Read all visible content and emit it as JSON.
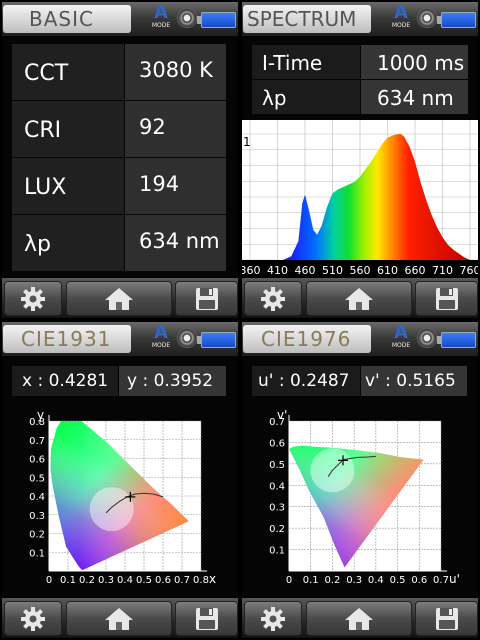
{
  "icons": {
    "mode": "mode-a-icon",
    "disc": "disc-icon",
    "battery": "battery-icon",
    "settings": "gear-icon",
    "home": "home-icon",
    "save": "floppy-disk-icon"
  },
  "mode_label": "A",
  "mode_sub": "MODE",
  "basic": {
    "title": "BASIC",
    "rows": [
      {
        "label": "CCT",
        "value": "3080 K"
      },
      {
        "label": "CRI",
        "value": "92"
      },
      {
        "label": "LUX",
        "value": "194"
      },
      {
        "label": "λp",
        "value": "634 nm"
      }
    ]
  },
  "spectrum": {
    "title": "SPECTRUM",
    "itime_label": "I-Time",
    "itime_value": "1000 ms",
    "peak_label": "λp",
    "peak_value": "634 nm",
    "chart_data": {
      "type": "area",
      "x_ticks": [
        "360",
        "410",
        "460",
        "510",
        "560",
        "610",
        "660",
        "710",
        "760"
      ],
      "ylim": [
        0,
        1
      ],
      "y_tick": "1",
      "x": [
        360,
        400,
        420,
        435,
        448,
        455,
        460,
        468,
        475,
        482,
        490,
        500,
        510,
        520,
        530,
        540,
        550,
        560,
        570,
        580,
        590,
        600,
        610,
        620,
        630,
        634,
        640,
        650,
        660,
        670,
        680,
        690,
        700,
        710,
        720,
        730,
        740,
        750,
        760
      ],
      "values": [
        0,
        0,
        0,
        0.03,
        0.15,
        0.45,
        0.52,
        0.38,
        0.24,
        0.2,
        0.27,
        0.42,
        0.53,
        0.56,
        0.58,
        0.6,
        0.62,
        0.66,
        0.72,
        0.78,
        0.85,
        0.92,
        0.97,
        0.99,
        1.0,
        1.0,
        0.98,
        0.9,
        0.78,
        0.62,
        0.48,
        0.36,
        0.26,
        0.18,
        0.12,
        0.08,
        0.05,
        0.02,
        0
      ]
    }
  },
  "cie1931": {
    "title": "CIE1931",
    "x_label": "x",
    "x_value": ": 0.4281",
    "y_label": "y",
    "y_value": ": 0.3952",
    "axis_x": "x",
    "axis_y": "y",
    "x_ticks": [
      "0",
      "0.1",
      "0.2",
      "0.3",
      "0.4",
      "0.5",
      "0.6",
      "0.7",
      "0.8"
    ],
    "y_ticks": [
      "0",
      "0.1",
      "0.2",
      "0.3",
      "0.4",
      "0.5",
      "0.6",
      "0.7",
      "0.8"
    ],
    "point": [
      0.4281,
      0.3952
    ]
  },
  "cie1976": {
    "title": "CIE1976",
    "u_label": "u'",
    "u_value": ": 0.2487",
    "v_label": "v'",
    "v_value": ": 0.5165",
    "axis_x": "u'",
    "axis_y": "v'",
    "x_ticks": [
      "0",
      "0.1",
      "0.2",
      "0.3",
      "0.4",
      "0.5",
      "0.6",
      "0.7"
    ],
    "y_ticks": [
      "0",
      "0.1",
      "0.2",
      "0.3",
      "0.4",
      "0.5",
      "0.6",
      "0.7"
    ],
    "point": [
      0.2487,
      0.5165
    ]
  }
}
